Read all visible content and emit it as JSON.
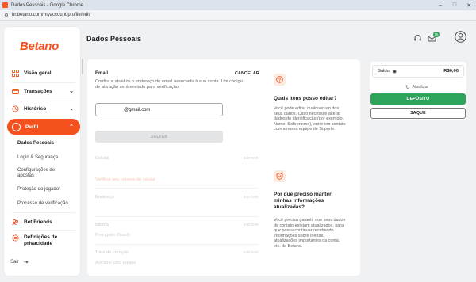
{
  "browser": {
    "window_title": "Dados Pessoais - Google Chrome",
    "url": "br.betano.com/myaccount/profile/edit"
  },
  "sidebar": {
    "logo": "Betano",
    "items": [
      {
        "label": "Visão geral"
      },
      {
        "label": "Transações"
      },
      {
        "label": "Histórico"
      },
      {
        "label": "Perfil"
      },
      {
        "label": "Bet Friends"
      },
      {
        "label": "Definições de privacidade"
      }
    ],
    "perfil_subitems": [
      "Dados Pessoais",
      "Login & Segurança",
      "Configurações de apostas",
      "Proteção do jogador",
      "Processo de verificação"
    ],
    "logout_label": "Sair"
  },
  "header": {
    "title": "Dados Pessoais",
    "notification_count": "15"
  },
  "form": {
    "email": {
      "label": "Email",
      "cancel": "CANCELAR",
      "description": "Confira e atualize o endereço de email associado à sua conta. Um código de ativação será enviado para verificação.",
      "value": "@gmail.com",
      "save": "SALVAR"
    },
    "fields": [
      {
        "label": "Celular",
        "edit": "EDITAR",
        "value": "Verificar seu número de celular"
      },
      {
        "label": "Endereço",
        "edit": "EDITAR",
        "value": ""
      },
      {
        "label": "Idioma",
        "edit": "EDITAR",
        "value": "Português (Brasil)"
      },
      {
        "label": "Time do coração",
        "edit": "EDITAR",
        "value": "Adicione uma equipe"
      }
    ]
  },
  "info_cards": [
    {
      "title": "Quais itens posso editar?",
      "text": "Você pode editar qualquer um dos seus dados. Caso necessite alterar dados de identificação (por exemplo, Nome, Sobrenome), entre em contato com a nossa equipe de Suporte."
    },
    {
      "title": "Por que preciso manter minhas informações atualizadas?",
      "text": "Você precisa garantir que seus dados de contato estejam atualizados, para que possa continuar recebendo informações sobre ofertas, atualizações importantes da conta, etc. da Betano."
    }
  ],
  "balance": {
    "label": "Saldo",
    "value": "R$0,00",
    "refresh": "Atualizar",
    "deposit": "DEPÓSITO",
    "withdraw": "SAQUE"
  },
  "colors": {
    "brand": "#f4511e",
    "deposit_green": "#2ea35a"
  }
}
